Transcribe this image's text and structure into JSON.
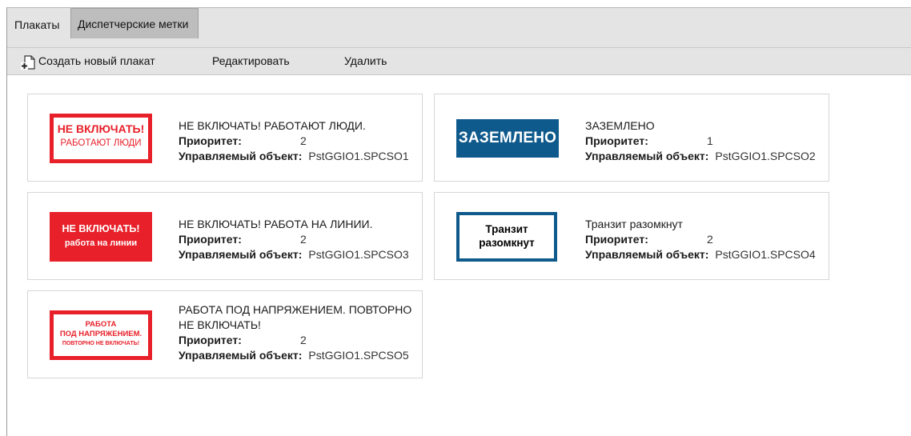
{
  "tabs": [
    {
      "label": "Плакаты"
    },
    {
      "label": "Диспетчерские метки"
    }
  ],
  "toolbar": {
    "create_label": "Создать новый плакат",
    "edit_label": "Редактировать",
    "delete_label": "Удалить"
  },
  "labels": {
    "priority": "Приоритет:",
    "object": "Управляемый объект:"
  },
  "colors": {
    "sign_red": "#e8202a",
    "sign_blue": "#0f5a8c"
  },
  "cards": [
    {
      "title": "НЕ ВКЛЮЧАТЬ! РАБОТАЮТ ЛЮДИ.",
      "priority": "2",
      "object": "PstGGIO1.SPCSO1",
      "sign_lines": [
        "НЕ ВКЛЮЧАТЬ!",
        "РАБОТАЮТ ЛЮДИ"
      ]
    },
    {
      "title": "ЗАЗЕМЛЕНО",
      "priority": "1",
      "object": "PstGGIO1.SPCSO2",
      "sign_lines": [
        "ЗАЗЕМЛЕНО"
      ]
    },
    {
      "title": "НЕ ВКЛЮЧАТЬ! РАБОТА НА ЛИНИИ.",
      "priority": "2",
      "object": "PstGGIO1.SPCSO3",
      "sign_lines": [
        "НЕ ВКЛЮЧАТЬ!",
        "работа на линии"
      ]
    },
    {
      "title": "Транзит разомкнут",
      "priority": "2",
      "object": "PstGGIO1.SPCSO4",
      "sign_lines": [
        "Транзит",
        "разомкнут"
      ]
    },
    {
      "title": "РАБОТА ПОД НАПРЯЖЕНИЕМ. ПОВТОРНО НЕ ВКЛЮЧАТЬ!",
      "priority": "2",
      "object": "PstGGIO1.SPCSO5",
      "sign_lines": [
        "РАБОТА",
        "ПОД НАПРЯЖЕНИЕМ.",
        "ПОВТОРНО НЕ ВКЛЮЧАТЬ!"
      ]
    }
  ]
}
